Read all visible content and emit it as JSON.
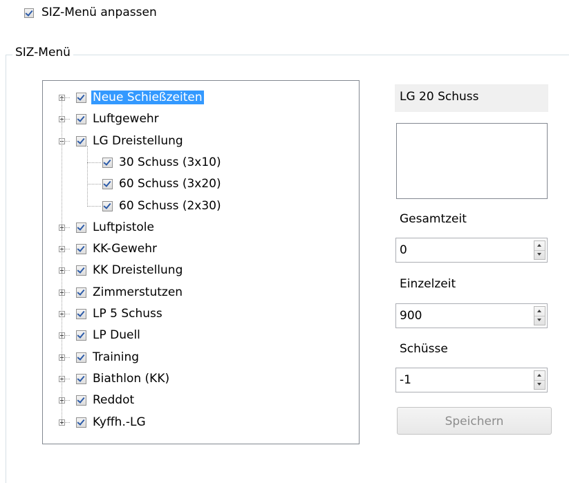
{
  "header": {
    "customize_label": "SIZ-Menü anpassen",
    "customize_checked": true
  },
  "group": {
    "label": "SIZ-Menü"
  },
  "tree": {
    "items": [
      {
        "label": "Neue Schießzeiten",
        "expander": "plus",
        "checked": true,
        "selected": true
      },
      {
        "label": "Luftgewehr",
        "expander": "plus",
        "checked": true
      },
      {
        "label": "LG Dreistellung",
        "expander": "minus",
        "checked": true
      },
      {
        "label": "30 Schuss (3x10)",
        "checked": true,
        "child": true
      },
      {
        "label": "60 Schuss (3x20)",
        "checked": true,
        "child": true
      },
      {
        "label": "60 Schuss (2x30)",
        "checked": true,
        "child": true
      },
      {
        "label": "Luftpistole",
        "expander": "plus",
        "checked": true
      },
      {
        "label": "KK-Gewehr",
        "expander": "plus",
        "checked": true
      },
      {
        "label": "KK Dreistellung",
        "expander": "plus",
        "checked": true
      },
      {
        "label": "Zimmerstutzen",
        "expander": "plus",
        "checked": true
      },
      {
        "label": "LP 5 Schuss",
        "expander": "plus",
        "checked": true
      },
      {
        "label": "LP Duell",
        "expander": "plus",
        "checked": true
      },
      {
        "label": "Training",
        "expander": "plus",
        "checked": true
      },
      {
        "label": "Biathlon (KK)",
        "expander": "plus",
        "checked": true
      },
      {
        "label": "Reddot",
        "expander": "plus",
        "checked": true
      },
      {
        "label": "Kyffh.-LG",
        "expander": "plus",
        "checked": true
      }
    ]
  },
  "details": {
    "name": "LG 20 Schuss",
    "description": "",
    "total_time_label": "Gesamtzeit",
    "total_time_value": "0",
    "single_time_label": "Einzelzeit",
    "single_time_value": "900",
    "shots_label": "Schüsse",
    "shots_value": "-1",
    "save_label": "Speichern"
  },
  "colors": {
    "selection": "#3399ff",
    "check": "#2b5aa8",
    "disabled_text": "#8c8c8c"
  }
}
